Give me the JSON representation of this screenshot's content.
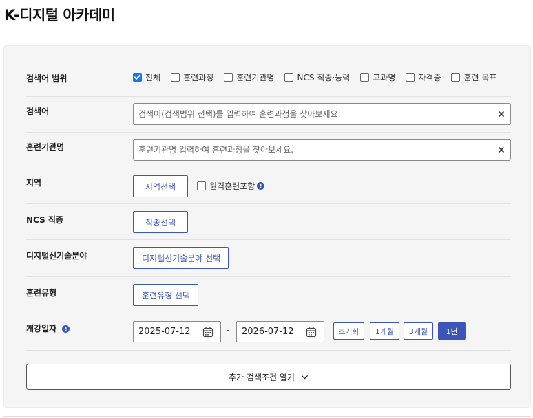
{
  "page": {
    "title": "K-디지털 아카데미"
  },
  "scope": {
    "label": "검색어 범위",
    "options": [
      {
        "label": "전체",
        "checked": true
      },
      {
        "label": "훈련과정",
        "checked": false
      },
      {
        "label": "훈련기관명",
        "checked": false
      },
      {
        "label": "NCS 직종·능력",
        "checked": false
      },
      {
        "label": "교과명",
        "checked": false
      },
      {
        "label": "자격증",
        "checked": false
      },
      {
        "label": "훈련 목표",
        "checked": false
      }
    ]
  },
  "keyword": {
    "label": "검색어",
    "value": "",
    "placeholder": "검색어(검색범위 선택)를 입력하여 훈련과정을 찾아보세요."
  },
  "institution": {
    "label": "훈련기관명",
    "value": "",
    "placeholder": "훈련기관명 입력하여 훈련과정을 찾아보세요."
  },
  "region": {
    "label": "지역",
    "button": "지역선택",
    "remote_label": "원격훈련포함",
    "remote_checked": false,
    "info_icon": "info-icon"
  },
  "ncs": {
    "label": "NCS 직종",
    "button": "직종선택"
  },
  "digital": {
    "label": "디지털신기술분야",
    "button": "디지털신기술분야 선택"
  },
  "training_type": {
    "label": "훈련유형",
    "button": "훈련유형 선택"
  },
  "date": {
    "label": "개강일자",
    "info_icon": "info-icon",
    "start": "2025-07-12",
    "separator": "-",
    "end": "2026-07-12",
    "calendar_icon": "calendar-icon",
    "buttons": [
      {
        "label": "초기화",
        "active": false
      },
      {
        "label": "1개월",
        "active": false
      },
      {
        "label": "3개월",
        "active": false
      },
      {
        "label": "1년",
        "active": true
      }
    ]
  },
  "more": {
    "label": "추가 검색조건 열기",
    "icon": "chevron-down-icon"
  },
  "colors": {
    "accent": "#3b56b8",
    "checkbox": "#1a73e8",
    "panel": "#f5f5f5"
  }
}
